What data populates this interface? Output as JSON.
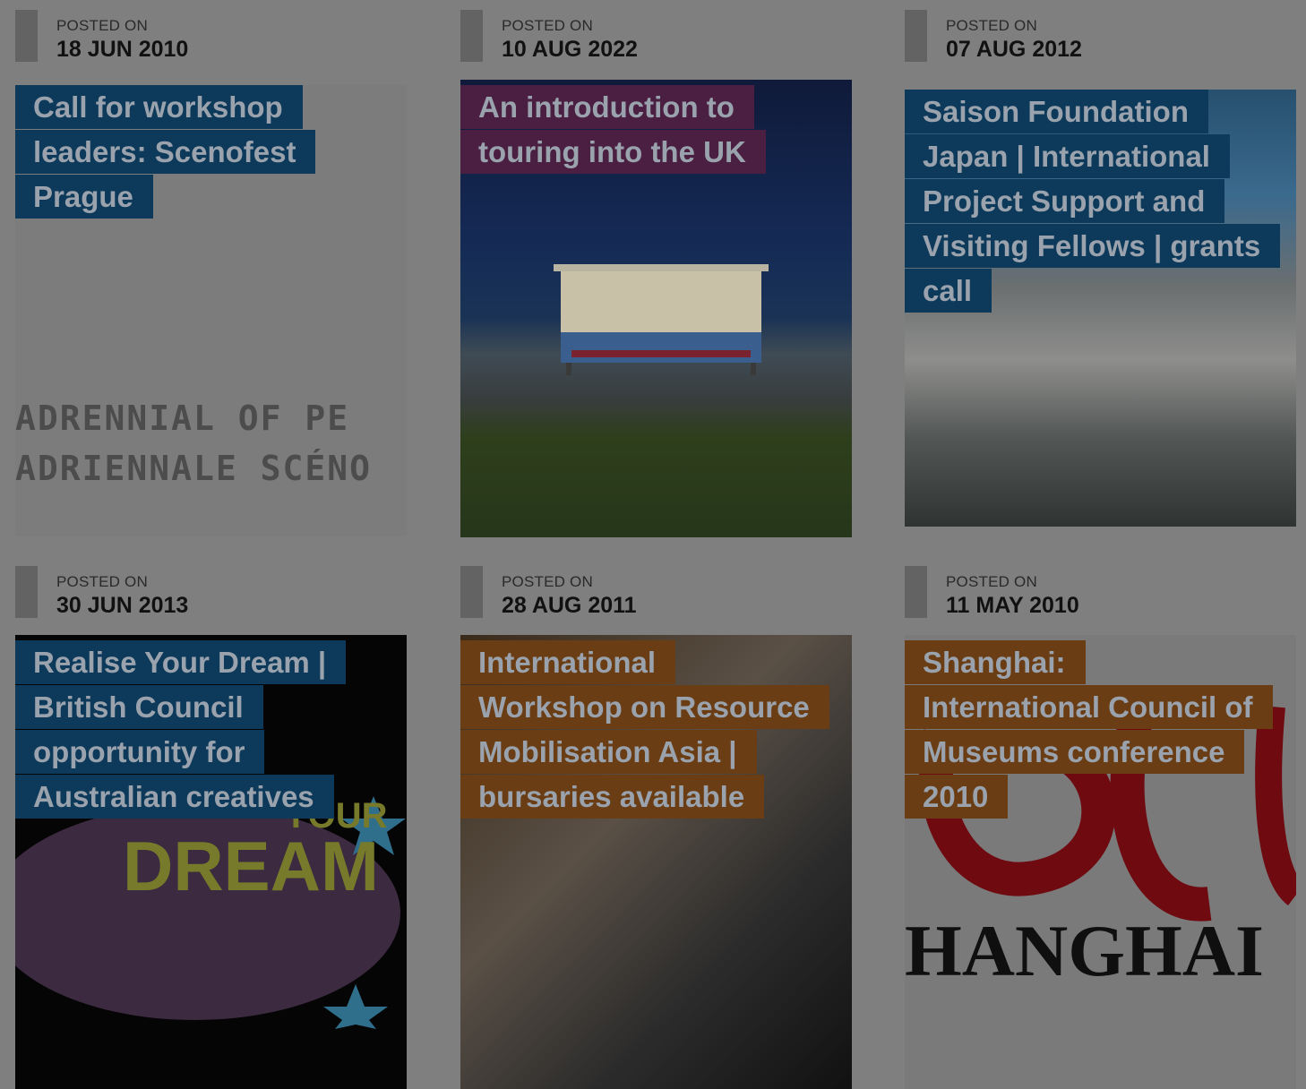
{
  "posted_label": "POSTED ON",
  "cards": [
    {
      "date": "18 JUN 2010",
      "title": "Call for workshop leaders: Scenofest Prague",
      "title_lines": [
        "Call for workshop",
        "leaders: Scenofest",
        "Prague"
      ],
      "title_color": "#0d3a5a",
      "image_text": [
        "ADRENNIAL OF PE",
        "ADRIENNALE SCÉNO"
      ]
    },
    {
      "date": "10 AUG 2022",
      "title": "An introduction to touring into the UK",
      "title_lines": [
        "An introduction to",
        "touring into the UK"
      ],
      "title_color": "#4a1f42"
    },
    {
      "date": "07 AUG 2012",
      "title": "Saison Foundation Japan | International Project Support and Visiting Fellows | grants call",
      "title_lines": [
        "Saison Foundation",
        "Japan | International",
        "Project Support and",
        "Visiting Fellows | grants",
        "call"
      ],
      "title_color": "#0d3a5a"
    },
    {
      "date": "30 JUN 2013",
      "title": "Realise Your Dream | British Council opportunity for Australian creatives",
      "title_lines": [
        "Realise Your Dream |",
        "British Council",
        "opportunity for",
        "Australian creatives"
      ],
      "title_color": "#0d3a5a",
      "image_text": [
        "DREAM",
        "YOUR"
      ]
    },
    {
      "date": "28 AUG 2011",
      "title": "International Workshop on Resource Mobilisation Asia | bursaries available",
      "title_lines": [
        "International",
        "Workshop on Resource",
        "Mobilisation Asia |",
        "bursaries available"
      ],
      "title_color": "#6a3d14"
    },
    {
      "date": "11 MAY 2010",
      "title": "Shanghai: International Council of Museums conference 2010",
      "title_lines": [
        "Shanghai:",
        "International Council of",
        "Museums conference",
        "2010"
      ],
      "title_color": "#6a3d14",
      "image_text": [
        "HANGHAI"
      ]
    }
  ],
  "colors": {
    "overlay": "#7f7f7f",
    "blue_title": "#0d3a5a",
    "purple_title": "#4a1f42",
    "brown_title": "#6a3d14",
    "title_text": "#9aa3ad"
  }
}
